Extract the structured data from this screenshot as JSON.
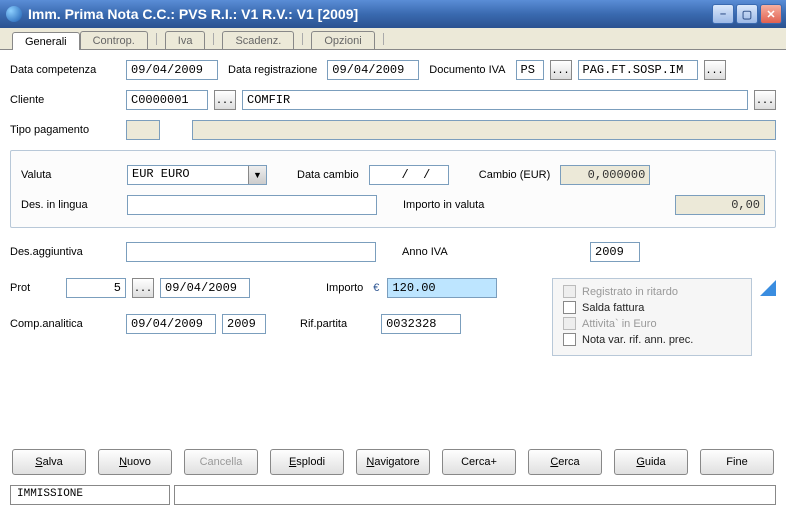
{
  "titlebar": {
    "text": "Imm. Prima Nota C.C.: PVS  R.I.: V1  R.V.: V1   [2009]"
  },
  "tabs": {
    "t0": "Generali",
    "t1": "Controp.",
    "t2": "Iva",
    "t3": "Scadenz.",
    "t4": "Opzioni"
  },
  "labels": {
    "data_comp": "Data competenza",
    "data_reg": "Data registrazione",
    "doc_iva": "Documento IVA",
    "cliente": "Cliente",
    "tipo_pag": "Tipo pagamento",
    "valuta": "Valuta",
    "data_cambio": "Data cambio",
    "cambio": "Cambio   (EUR)",
    "des_lingua": "Des. in lingua",
    "importo_valuta": "Importo in valuta",
    "des_agg": "Des.aggiuntiva",
    "anno_iva": "Anno IVA",
    "prot": "Prot",
    "importo": "Importo",
    "comp_anal": "Comp.analitica",
    "rif_partita": "Rif.partita"
  },
  "values": {
    "data_comp": "09/04/2009",
    "data_reg": "09/04/2009",
    "doc_iva_code": "PS",
    "doc_iva_desc": "PAG.FT.SOSP.IM",
    "cliente_code": "C0000001",
    "cliente_name": "COMFIR",
    "tipo_pag_code": "",
    "tipo_pag_desc": "",
    "valuta": "EUR EURO",
    "data_cambio": "  /  /",
    "cambio": "0,000000",
    "des_lingua": "",
    "importo_valuta": "0,00",
    "des_agg": "",
    "anno_iva": "2009",
    "prot_num": "5",
    "prot_date": "09/04/2009",
    "importo": "120.00",
    "comp_anal_date": "09/04/2009",
    "comp_anal_year": "2009",
    "rif_partita": "0032328"
  },
  "checks": {
    "reg_ritardo": "Registrato in ritardo",
    "salda_fattura": "Salda fattura",
    "att_euro": "Attivita` in Euro",
    "nota_var": "Nota var. rif. ann. prec."
  },
  "buttons": {
    "salva": "alva",
    "nuovo": "uovo",
    "cancella": "Cancella",
    "esplodi": "splodi",
    "navigatore": "avigatore",
    "cercaplus": "Cerca+",
    "cerca": "erca",
    "guida": "uida",
    "fine": "Fine"
  },
  "status": {
    "mode": "IMMISSIONE"
  },
  "ellipsis": "..."
}
